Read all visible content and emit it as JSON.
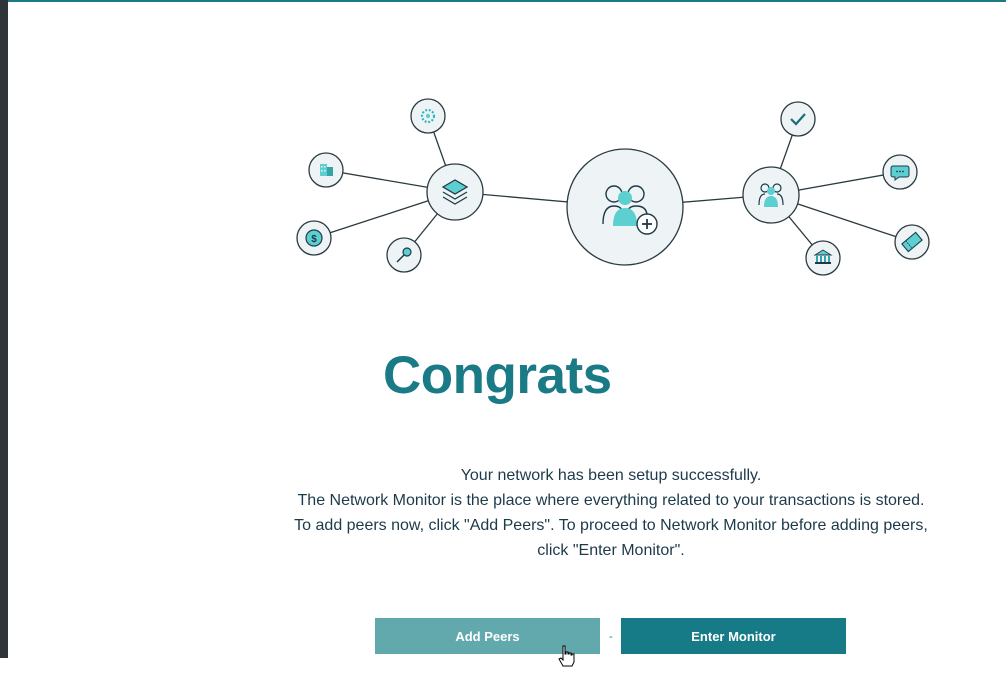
{
  "page": {
    "title": "Congrats",
    "message_lines": [
      "Your network has been setup successfully.",
      "The Network Monitor is the place where everything related to your transactions is stored.",
      "To add peers now, click \"Add Peers\". To proceed to Network Monitor before adding peers,",
      "click \"Enter Monitor\"."
    ],
    "separator": "-"
  },
  "buttons": {
    "add_peers": "Add Peers",
    "enter_monitor": "Enter Monitor"
  },
  "colors": {
    "accent": "#1a7b87",
    "add_peers_bg": "#62a9ae",
    "enter_monitor_bg": "#167b86",
    "node_fill": "#eef4f5",
    "icon_teal": "#5ccfd0"
  },
  "illustration": {
    "icons": [
      "gear-icon",
      "building-icon",
      "dollar-coin-icon",
      "key-icon",
      "layers-icon",
      "add-group-icon",
      "checkmark-icon",
      "chat-bubble-icon",
      "ticket-icon",
      "bank-icon",
      "people-icon"
    ]
  }
}
